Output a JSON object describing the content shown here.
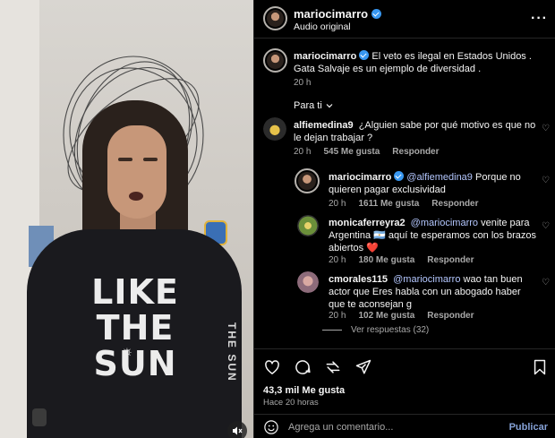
{
  "colors": {
    "accent": "#3897f0",
    "background": "#000000",
    "muted": "#a8a8a8",
    "mention": "#b4c7ff",
    "heart": "#ed4956"
  },
  "video": {
    "shirt_text": "LIKE\nTHE\nSUN",
    "sleeve_text": "THE SUN",
    "mute_icon": "speaker-muted-icon"
  },
  "header": {
    "username": "mariocimarro",
    "subtitle": "Audio original",
    "more_icon": "more-horizontal-icon"
  },
  "caption": {
    "username": "mariocimarro",
    "text": "El veto es ilegal en Estados Unidos . Gata Salvaje es un ejemplo de diversidad .",
    "time": "20 h"
  },
  "sort": {
    "label": "Para ti",
    "icon": "chevron-down-icon"
  },
  "comments": [
    {
      "username": "alfiemedina9",
      "text": "¿Alguien sabe por qué motivo es que no le dejan trabajar ?",
      "time": "20 h",
      "likes": "545 Me gusta",
      "reply": "Responder"
    },
    {
      "username": "mariocimarro",
      "mention": "@alfiemedina9",
      "text": "Porque no quieren pagar exclusividad",
      "time": "20 h",
      "likes": "1611 Me gusta",
      "reply": "Responder"
    },
    {
      "username": "monicaferreyra2",
      "mention": "@mariocimarro",
      "text": "venite para Argentina 🇦🇷 aquí te esperamos con los brazos abiertos ❤️",
      "time": "20 h",
      "likes": "180 Me gusta",
      "reply": "Responder"
    },
    {
      "username": "cmorales115",
      "mention": "@mariocimarro",
      "text": "wao tan buen actor que Eres habla con un abogado haber que te aconsejan g",
      "time": "20 h",
      "likes": "102 Me gusta",
      "reply": "Responder"
    }
  ],
  "view_replies": "Ver respuestas (32)",
  "actions": [
    "heart-icon",
    "comment-icon",
    "share-icon",
    "send-icon",
    "bookmark-icon"
  ],
  "likes_total": "43,3 mil Me gusta",
  "posted_ago": "Hace 20 horas",
  "composer": {
    "placeholder": "Agrega un comentario...",
    "post_label": "Publicar",
    "emoji_icon": "smiley-icon"
  }
}
